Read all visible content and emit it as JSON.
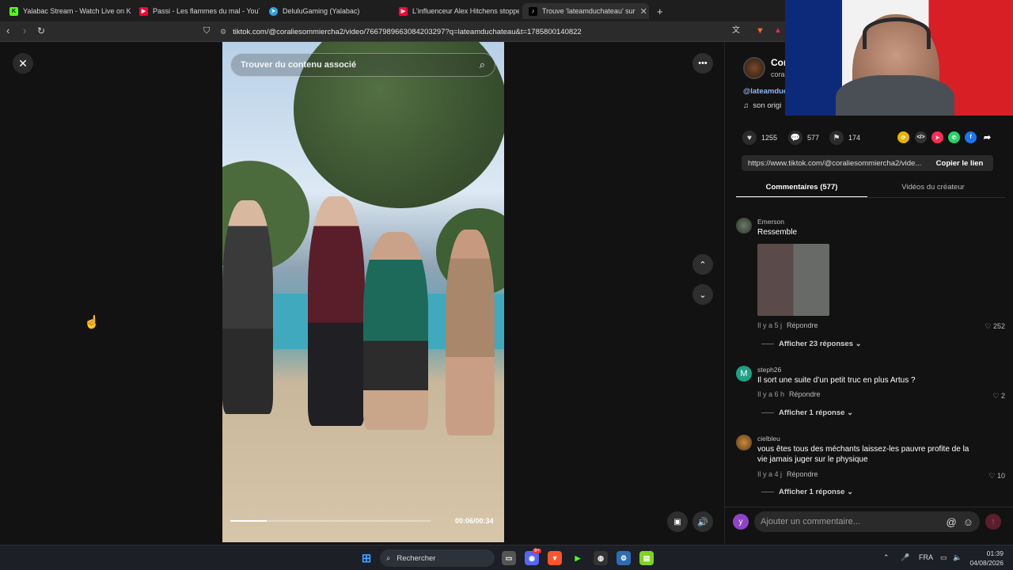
{
  "browser": {
    "tabs": [
      {
        "title": "Yalabac Stream - Watch Live on Kick",
        "icon": "kick-icon",
        "color": "#53fc18"
      },
      {
        "title": "Passi - Les flammes du mal - YouTube",
        "icon": "youtube-icon",
        "color": "#ff0033"
      },
      {
        "title": "DeluluGaming (Yalabac)",
        "icon": "telegram-icon",
        "color": "#2aa3de"
      },
      {
        "title": "L'influenceur Alex Hitchens stoppe b",
        "icon": "youtube-icon",
        "color": "#ff0033"
      },
      {
        "title": "Trouve 'lateamduchateau' sur",
        "icon": "tiktok-icon",
        "color": "#000000",
        "active": true
      }
    ],
    "new_tab": "+",
    "url": "tiktok.com/@coraliesommiercha2/video/7667989663084203297?q=lateamduchateau&t=1785800140822"
  },
  "video": {
    "search_placeholder": "Trouver du contenu associé",
    "timecode": "00:06/00:34",
    "progress": 0.18
  },
  "panel": {
    "author_name": "Cor",
    "author_handle": "cora",
    "hashtag": "@lateamduc",
    "sound": "son origi",
    "stats": {
      "likes": "1255",
      "comments": "577",
      "saves": "174"
    },
    "share_link": "https://www.tiktok.com/@coraliesommiercha2/vide...",
    "copy_label": "Copier le lien",
    "tabs": {
      "comments": "Commentaires (577)",
      "creator_videos": "Vidéos du créateur"
    },
    "comments": [
      {
        "user": "Emerson",
        "text": "Ressemble",
        "time": "Il y a 5 j",
        "reply": "Répondre",
        "likes": "252",
        "replies": "Afficher 23 réponses"
      },
      {
        "user": "steph26",
        "text": "Il sort une suite d’un petit truc en plus Artus ?",
        "time": "Il y a 6 h",
        "reply": "Répondre",
        "likes": "2",
        "replies": "Afficher 1 réponse",
        "avatar_letter": "M"
      },
      {
        "user": "cielbleu",
        "text": "vous êtes tous des méchants laissez-les pauvre profite de la vie jamais juger sur le physique",
        "time": "Il y a 4 j",
        "reply": "Répondre",
        "likes": "10",
        "replies": "Afficher 1 réponse"
      }
    ],
    "comment_placeholder": "Ajouter un commentaire...",
    "user_initial": "y"
  },
  "taskbar": {
    "search": "Rechercher",
    "lang": "FRA",
    "time": "01:39",
    "date": "04/08/2026",
    "discord_badge": "9+"
  },
  "colors": {
    "accent": "#fe2c55",
    "link": "#8fb7ff"
  }
}
